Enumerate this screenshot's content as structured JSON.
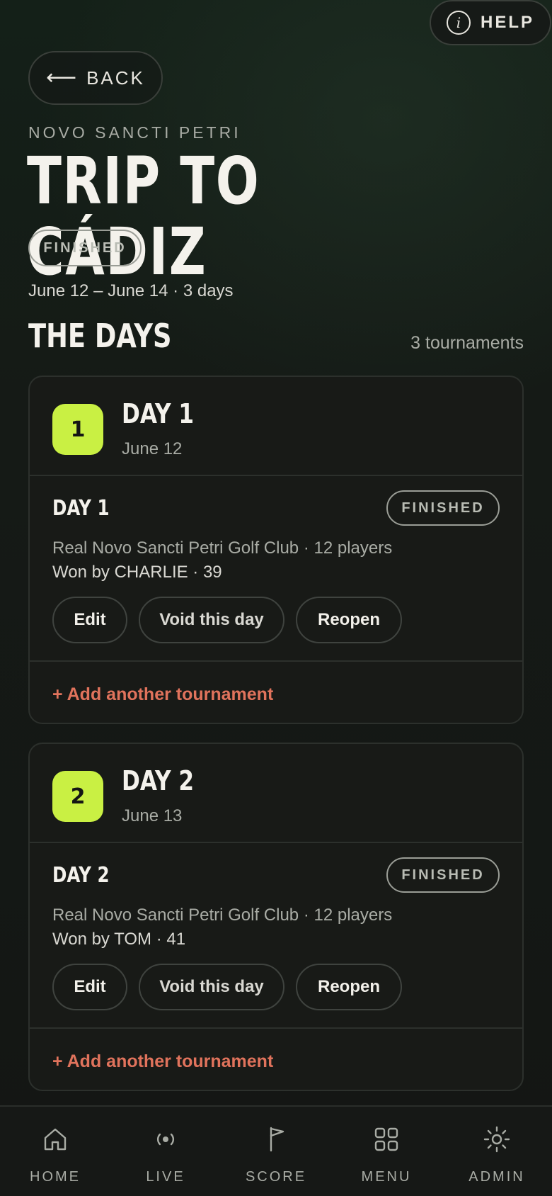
{
  "header": {
    "help_label": "HELP",
    "back_label": "BACK",
    "location": "NOVO SANCTI PETRI",
    "title": "TRIP TO CÁDIZ",
    "status": "FINISHED",
    "dates": "June 12 – June 14 · 3 days"
  },
  "section": {
    "title": "THE DAYS",
    "count": "3 tournaments"
  },
  "days": [
    {
      "number": "1",
      "name": "DAY 1",
      "date": "June 12",
      "tournament": {
        "name": "DAY 1",
        "status": "FINISHED",
        "meta": "Real Novo Sancti Petri Golf Club · 12 players",
        "winner": "Won by CHARLIE · 39",
        "edit_label": "Edit",
        "void_label": "Void this day",
        "reopen_label": "Reopen"
      },
      "add_label": "+ Add another tournament"
    },
    {
      "number": "2",
      "name": "DAY 2",
      "date": "June 13",
      "tournament": {
        "name": "DAY 2",
        "status": "FINISHED",
        "meta": "Real Novo Sancti Petri Golf Club · 12 players",
        "winner": "Won by TOM · 41",
        "edit_label": "Edit",
        "void_label": "Void this day",
        "reopen_label": "Reopen"
      },
      "add_label": "+ Add another tournament"
    }
  ],
  "nav": {
    "items": [
      {
        "label": "HOME",
        "icon": "home-icon"
      },
      {
        "label": "LIVE",
        "icon": "live-icon"
      },
      {
        "label": "SCORE",
        "icon": "flag-icon"
      },
      {
        "label": "MENU",
        "icon": "grid-icon"
      },
      {
        "label": "ADMIN",
        "icon": "sun-icon"
      }
    ]
  },
  "colors": {
    "accent_badge": "#c9f043",
    "add_link": "#e0735c",
    "background": "#151815"
  }
}
